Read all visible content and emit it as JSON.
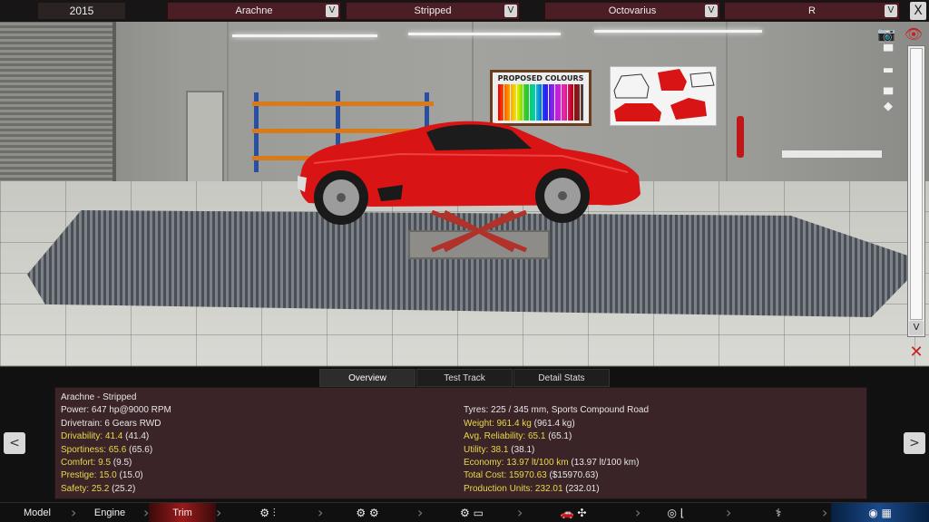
{
  "topbar": {
    "year": "2015",
    "model": "Arachne",
    "trim": "Stripped",
    "engine": "Octovarius",
    "variant": "R",
    "dropdown_arrow": "V",
    "close": "X"
  },
  "scene": {
    "poster_title": "PROPOSED COLOURS",
    "car_color": "#d81414"
  },
  "tabs": [
    "Overview",
    "Test Track",
    "Detail Stats"
  ],
  "panel": {
    "title": "Arachne - Stripped",
    "left": [
      {
        "label": "Power: ",
        "value": "647 hp@9000 RPM",
        "highlight": false
      },
      {
        "label": "Drivetrain: ",
        "value": "6 Gears RWD",
        "highlight": false
      },
      {
        "label": "Drivability: 41.4",
        "value": " (41.4)",
        "highlight": true
      },
      {
        "label": "Sportiness: 65.6",
        "value": " (65.6)",
        "highlight": true
      },
      {
        "label": "Comfort: 9.5",
        "value": " (9.5)",
        "highlight": true
      },
      {
        "label": "Prestige: 15.0",
        "value": " (15.0)",
        "highlight": true
      },
      {
        "label": "Safety: 25.2",
        "value": " (25.2)",
        "highlight": true
      }
    ],
    "right": [
      {
        "label": "Tyres: ",
        "value": "225 / 345 mm, Sports Compound Road",
        "highlight": false
      },
      {
        "label": "Weight: 961.4 kg",
        "value": " (961.4 kg)",
        "highlight": true
      },
      {
        "label": "Avg. Reliability: 65.1",
        "value": " (65.1)",
        "highlight": true
      },
      {
        "label": "Utility: 38.1",
        "value": " (38.1)",
        "highlight": true
      },
      {
        "label": "Economy: 13.97 lt/100 km",
        "value": " (13.97 lt/100 km)",
        "highlight": true
      },
      {
        "label": "Total Cost: 15970.63",
        "value": " ($15970.63)",
        "highlight": true
      },
      {
        "label": "Production Units: 232.01",
        "value": " (232.01)",
        "highlight": true
      }
    ],
    "prev": "<",
    "next": ">"
  },
  "nav": {
    "model": "Model",
    "engine": "Engine",
    "trim": "Trim"
  },
  "colors": {
    "accent": "#9a1a1a",
    "panel": "#3a2427",
    "highlight": "#e8d84a"
  }
}
